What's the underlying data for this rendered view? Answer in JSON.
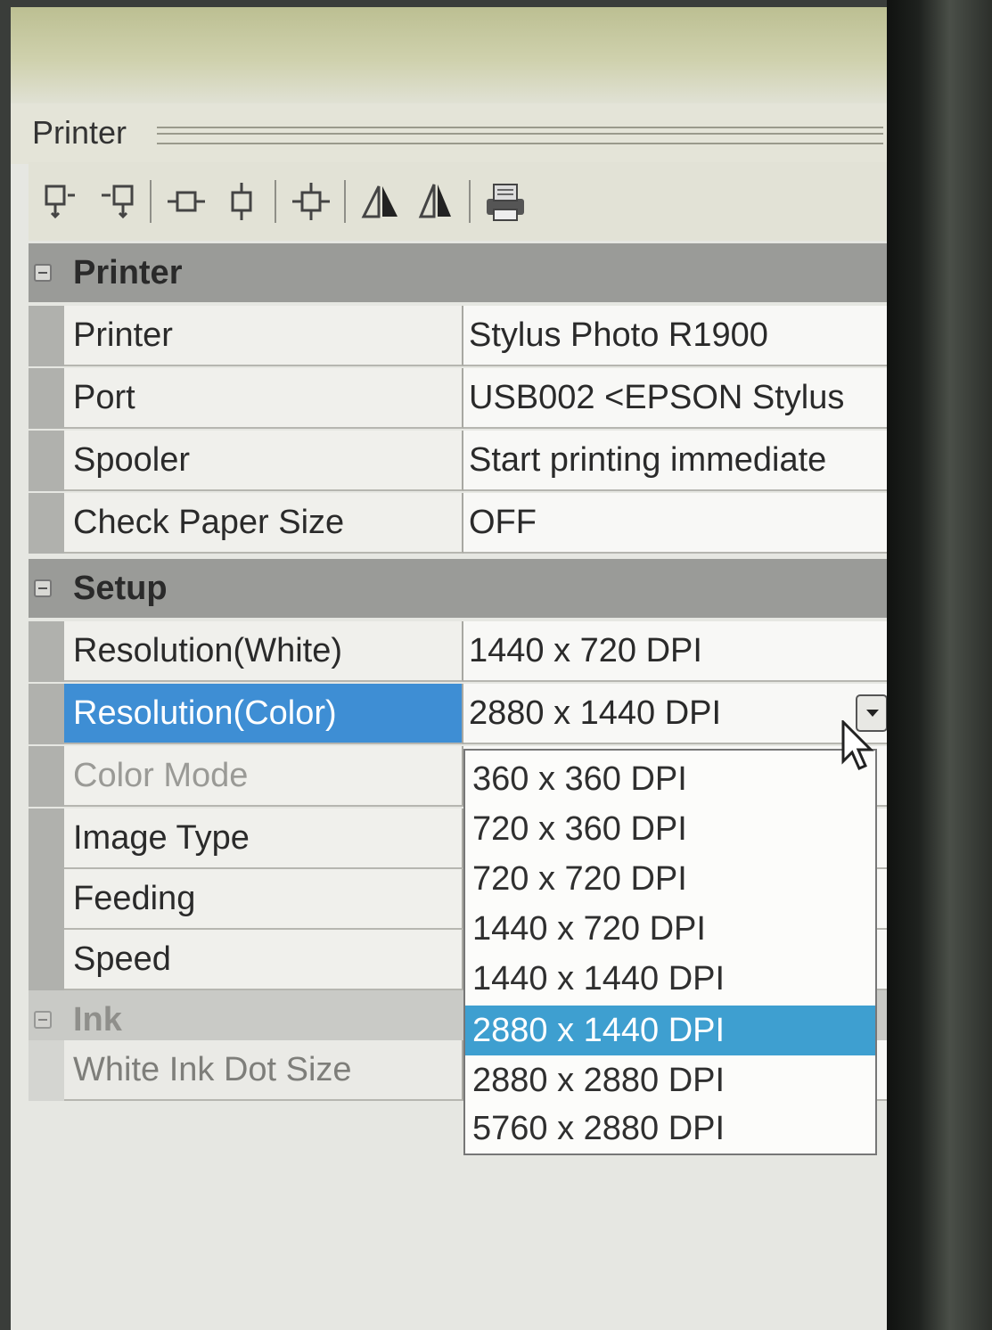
{
  "panel": {
    "title": "Printer"
  },
  "toolbar": {
    "icons": [
      "align-top-left-icon",
      "align-top-right-icon",
      "align-middle-horizontal-icon",
      "align-middle-vertical-icon",
      "center-icon",
      "flip-horizontal-icon",
      "flip-vertical-icon",
      "print-icon"
    ]
  },
  "grid": {
    "categories": [
      {
        "label": "Printer",
        "rows": [
          {
            "name": "Printer",
            "value": "Stylus Photo R1900"
          },
          {
            "name": "Port",
            "value": "USB002  <EPSON Stylus"
          },
          {
            "name": "Spooler",
            "value": "Start printing immediate"
          },
          {
            "name": "Check Paper Size",
            "value": "OFF"
          }
        ]
      },
      {
        "label": "Setup",
        "rows": [
          {
            "name": "Resolution(White)",
            "value": "1440 x 720 DPI"
          },
          {
            "name": "Resolution(Color)",
            "value": "2880 x 1440 DPI"
          },
          {
            "name": "Color Mode",
            "value": ""
          },
          {
            "name": "Image Type",
            "value": ""
          },
          {
            "name": "Feeding",
            "value": ""
          },
          {
            "name": "Speed",
            "value": ""
          }
        ]
      },
      {
        "label": "Ink",
        "rows": [
          {
            "name": "White Ink Dot Size",
            "value": ""
          }
        ]
      }
    ]
  },
  "dropdown": {
    "options": [
      "360 x 360 DPI",
      "720 x 360 DPI",
      "720 x 720 DPI",
      "1440 x 720 DPI",
      "1440 x 1440 DPI",
      "2880 x 1440 DPI",
      "2880 x 2880 DPI",
      "5760 x 2880 DPI"
    ],
    "selected": "2880 x 1440 DPI"
  },
  "colors": {
    "selection": "#3e8ed4",
    "category_bar": "#9a9b98"
  }
}
